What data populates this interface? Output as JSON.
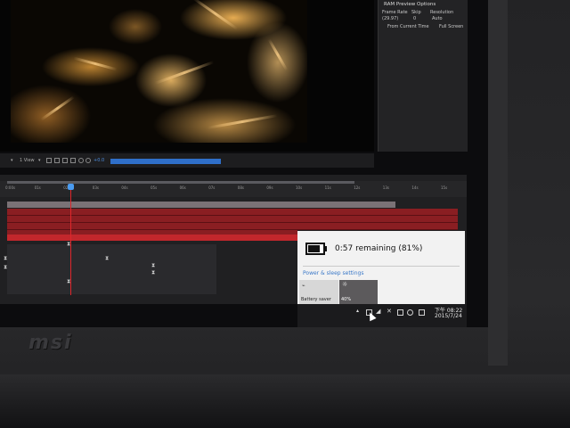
{
  "panel": {
    "title": "RAM Preview Options",
    "frame_rate_label": "Frame Rate",
    "skip_label": "Skip",
    "resolution_label": "Resolution",
    "frame_rate_value": "(29.97)",
    "skip_value": "0",
    "resolution_value": "Auto",
    "from_current": "From Current Time",
    "full_screen": "Full Screen"
  },
  "toolbar": {
    "view_label": "1 View",
    "exposure_value": "+0.0"
  },
  "timeline": {
    "ticks": [
      "0:00s",
      "01s",
      "02s",
      "03s",
      "04s",
      "05s",
      "06s",
      "07s",
      "08s",
      "09s",
      "10s",
      "11s",
      "12s",
      "13s",
      "14s",
      "15s"
    ]
  },
  "battery": {
    "remaining_text": "0:57 remaining (81%)",
    "percent": 81,
    "settings_link": "Power & sleep settings",
    "saver_label": "Battery saver",
    "brightness_label": "40%"
  },
  "clock": {
    "time": "下午 08:22",
    "date": "2015/7/24"
  },
  "brand": {
    "logo_text": "msi"
  },
  "colors": {
    "accent_blue": "#2f6fc9",
    "layer_red": "#8a1e22",
    "playhead": "#e0262b"
  }
}
